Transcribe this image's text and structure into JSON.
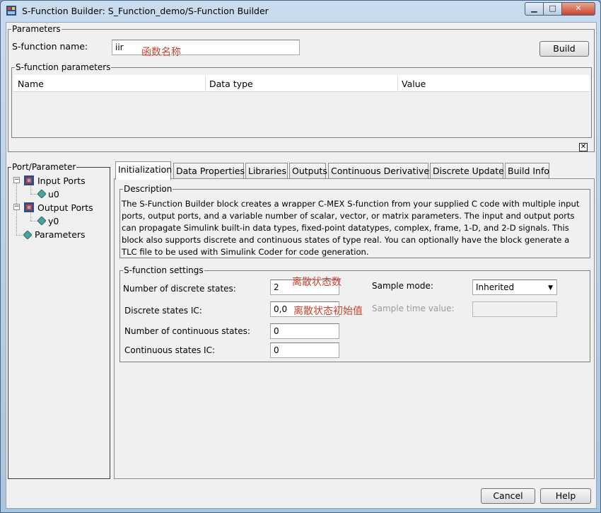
{
  "window": {
    "title": "S-Function Builder: S_Function_demo/S-Function Builder"
  },
  "parameters": {
    "legend": "Parameters",
    "name_label": "S-function name:",
    "name_value": "iir",
    "name_note": "函数名称",
    "build_label": "Build",
    "sfunc_params": {
      "legend": "S-function parameters",
      "columns": [
        "Name",
        "Data type",
        "Value"
      ]
    }
  },
  "port_parameter": {
    "legend": "Port/Parameter",
    "items": [
      "Input Ports",
      "u0",
      "Output Ports",
      "y0",
      "Parameters"
    ]
  },
  "tabs": [
    "Initialization",
    "Data Properties",
    "Libraries",
    "Outputs",
    "Continuous Derivatives",
    "Discrete Update",
    "Build Info"
  ],
  "description": {
    "legend": "Description",
    "lines": [
      "The S-Function Builder block creates a wrapper C-MEX S-function from your supplied C code with multiple input",
      "ports, output ports, and a variable number of scalar, vector, or matrix parameters. The input and output ports",
      "can propagate Simulink built-in data types, fixed-point datatypes, complex, frame, 1-D, and 2-D signals. This",
      "block also supports discrete and continuous states of type real. You can optionally have the block generate a",
      "TLC file to be used with Simulink Coder for code generation."
    ]
  },
  "settings": {
    "legend": "S-function settings",
    "discrete_states_label": "Number of discrete states:",
    "discrete_states_value": "2",
    "discrete_states_note": "离散状态数",
    "discrete_ic_label": "Discrete states IC:",
    "discrete_ic_value": "0,0",
    "discrete_ic_note": "离散状态初始值",
    "continuous_states_label": "Number of continuous states:",
    "continuous_states_value": "0",
    "continuous_ic_label": "Continuous states IC:",
    "continuous_ic_value": "0",
    "sample_mode_label": "Sample mode:",
    "sample_mode_value": "Inherited",
    "sample_time_label": "Sample time value:",
    "sample_time_value": ""
  },
  "footer": {
    "cancel_label": "Cancel",
    "help_label": "Help"
  }
}
